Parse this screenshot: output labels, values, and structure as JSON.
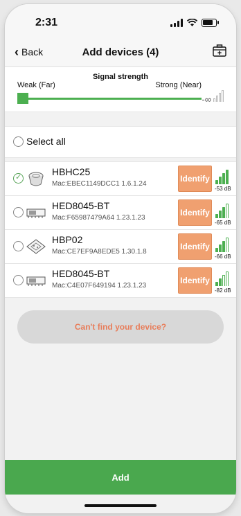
{
  "status": {
    "time": "2:31"
  },
  "nav": {
    "back_label": "Back",
    "title": "Add devices (4)"
  },
  "signal": {
    "title": "Signal strength",
    "weak_label": "Weak (Far)",
    "strong_label": "Strong (Near)",
    "infinity": "-∞",
    "slider_level": 0
  },
  "select_all": {
    "label": "Select all",
    "checked": false
  },
  "devices": [
    {
      "name": "HBHC25",
      "mac": "Mac:EBEC1149DCC1  1.6.1.24",
      "identify": "Identify",
      "rssi": "-53 dB",
      "bars": 4,
      "checked": true,
      "icon": "round-device-icon"
    },
    {
      "name": "HED8045-BT",
      "mac": "Mac:F65987479A64  1.23.1.23",
      "identify": "Identify",
      "rssi": "-65 dB",
      "bars": 3,
      "checked": false,
      "icon": "pcb-module-icon"
    },
    {
      "name": "HBP02",
      "mac": "Mac:CE7EF9A8EDE5  1.30.1.8",
      "identify": "Identify",
      "rssi": "-66 dB",
      "bars": 3,
      "checked": false,
      "icon": "square-board-icon"
    },
    {
      "name": "HED8045-BT",
      "mac": "Mac:C4E07F649194  1.23.1.23",
      "identify": "Identify",
      "rssi": "-82 dB",
      "bars": 2,
      "checked": false,
      "icon": "pcb-module-icon"
    }
  ],
  "cant_find_label": "Can't find your device?",
  "add_label": "Add",
  "colors": {
    "accent_green": "#4aa84e",
    "identify_orange": "#f0a070",
    "link_orange": "#e87d5a"
  }
}
